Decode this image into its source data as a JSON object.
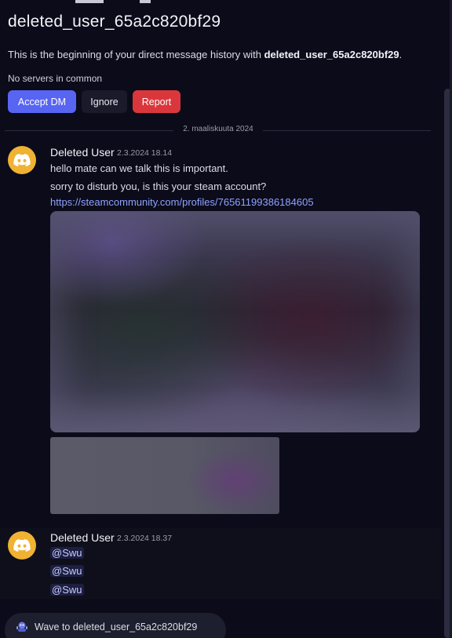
{
  "header": {
    "title": "deleted_user_65a2c820bf29"
  },
  "intro": {
    "prefix": "This is the beginning of your direct message history with ",
    "username": "deleted_user_65a2c820bf29",
    "suffix": "."
  },
  "mutual": {
    "no_servers": "No servers in common"
  },
  "actions": {
    "accept_label": "Accept DM",
    "ignore_label": "Ignore",
    "report_label": "Report"
  },
  "date_divider": "2. maaliskuuta 2024",
  "messages": [
    {
      "author": "Deleted User",
      "timestamp": "2.3.2024 18.14",
      "lines": [
        "hello mate can we talk this is important.",
        "sorry to disturb you, is this your steam account?"
      ],
      "link": "https://steamcommunity.com/profiles/76561199386184605"
    },
    {
      "author": "Deleted User",
      "timestamp": "2.3.2024 18.37",
      "mentions": [
        "@Swu",
        "@Swu",
        "@Swu"
      ]
    }
  ],
  "wave": {
    "label": "Wave to deleted_user_65a2c820bf29"
  },
  "colors": {
    "background": "#0b0b1a",
    "accent": "#5865f2",
    "danger": "#da373c",
    "avatar": "#f0b232",
    "link": "#8fa3ff"
  }
}
